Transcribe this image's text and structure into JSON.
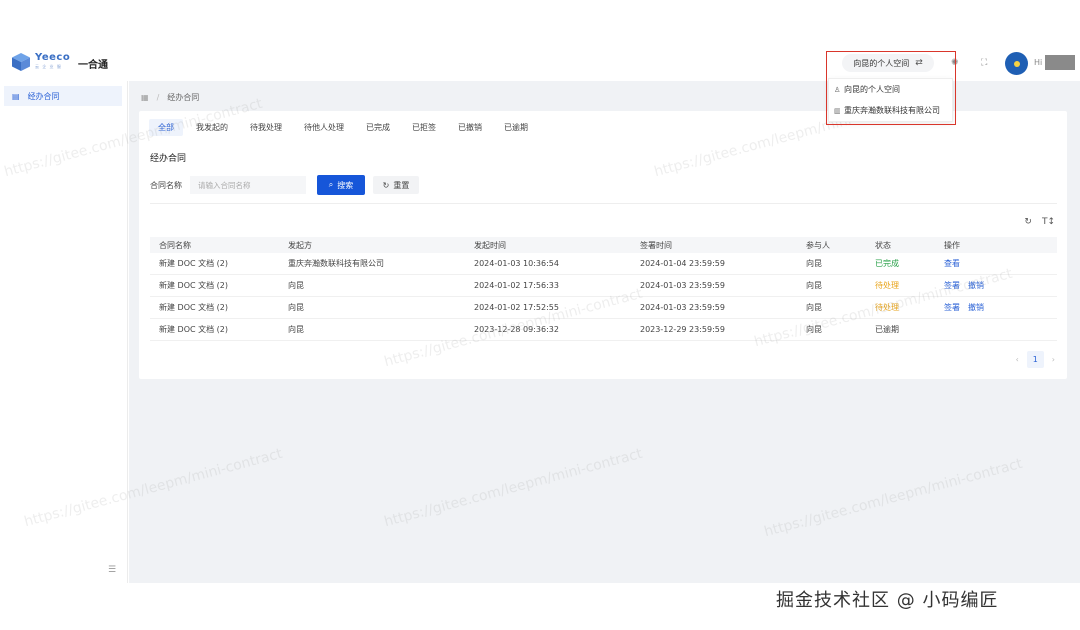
{
  "header": {
    "logo_word": "Yeeco",
    "logo_sub": "云 企 业 服",
    "app_name": "一合通",
    "space_switch": "向昆的个人空间",
    "greeting": "Hi"
  },
  "dropdown": {
    "items": [
      {
        "label": "向昆的个人空间",
        "icon": "user-icon"
      },
      {
        "label": "重庆奔瀚数联科技有限公司",
        "icon": "building-icon"
      }
    ]
  },
  "sidebar": {
    "items": [
      {
        "label": "经办合同",
        "icon": "document-icon"
      }
    ]
  },
  "breadcrumb": {
    "current": "经办合同"
  },
  "tabs": [
    "全部",
    "我发起的",
    "待我处理",
    "待他人处理",
    "已完成",
    "已拒签",
    "已撤销",
    "已逾期"
  ],
  "section_title": "经办合同",
  "filter": {
    "label": "合同名称",
    "placeholder": "请输入合同名称",
    "search_label": "搜索",
    "reset_label": "重置"
  },
  "table": {
    "columns": [
      "合同名称",
      "发起方",
      "发起时间",
      "签署时间",
      "参与人",
      "状态",
      "操作"
    ],
    "rows": [
      {
        "name": "新建 DOC 文档 (2)",
        "initiator": "重庆奔瀚数联科技有限公司",
        "start": "2024-01-03 10:36:54",
        "sign": "2024-01-04 23:59:59",
        "participant": "向昆",
        "status": "已完成",
        "status_kind": "done",
        "actions": [
          "查看"
        ]
      },
      {
        "name": "新建 DOC 文档 (2)",
        "initiator": "向昆",
        "start": "2024-01-02 17:56:33",
        "sign": "2024-01-03 23:59:59",
        "participant": "向昆",
        "status": "待处理",
        "status_kind": "pending",
        "actions": [
          "签署",
          "撤销"
        ]
      },
      {
        "name": "新建 DOC 文档 (2)",
        "initiator": "向昆",
        "start": "2024-01-02 17:52:55",
        "sign": "2024-01-03 23:59:59",
        "participant": "向昆",
        "status": "待处理",
        "status_kind": "pending",
        "actions": [
          "签署",
          "撤销"
        ]
      },
      {
        "name": "新建 DOC 文档 (2)",
        "initiator": "向昆",
        "start": "2023-12-28 09:36:32",
        "sign": "2023-12-29 23:59:59",
        "participant": "向昆",
        "status": "已逾期",
        "status_kind": "expired",
        "actions": []
      }
    ]
  },
  "pager": {
    "current": "1"
  },
  "watermark_text": "https://gitee.com/leepm/mini-contract",
  "footer": "掘金技术社区 @ 小码编匠",
  "colors": {
    "accent": "#1656d9",
    "done": "#2aa14a",
    "pending": "#e8a317",
    "highlight": "#d9362b"
  }
}
